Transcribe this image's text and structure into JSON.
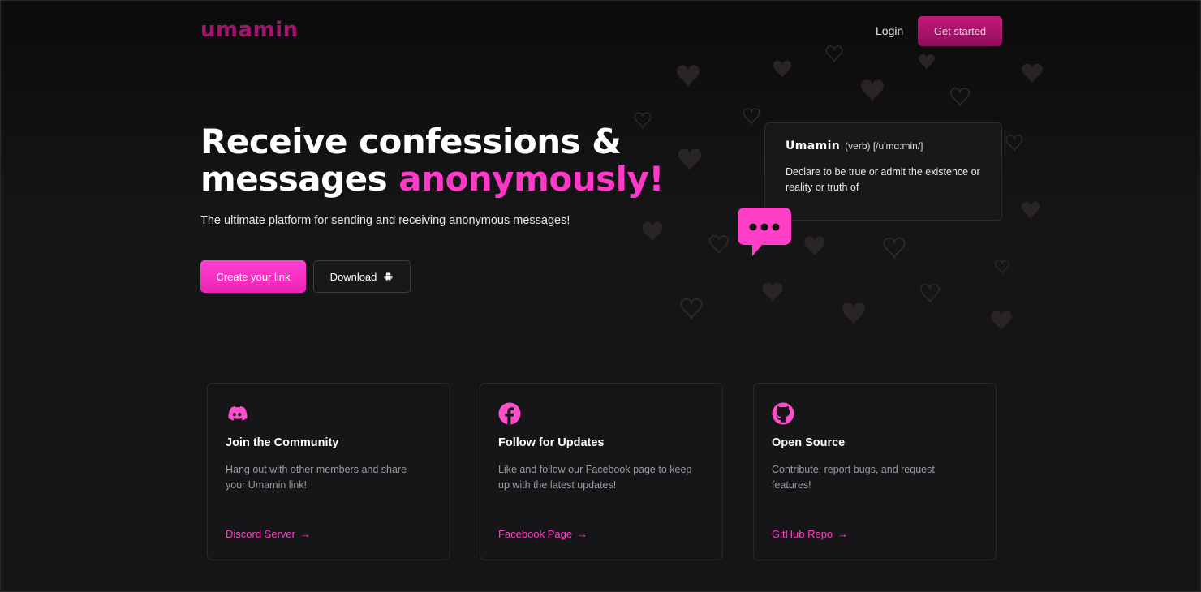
{
  "header": {
    "logo": "umamin",
    "login_label": "Login",
    "get_started_label": "Get started"
  },
  "hero": {
    "title_line1": "Receive confessions &",
    "title_line2_plain": "messages",
    "title_line2_accent": "anonymously!",
    "subtitle": "The ultimate platform for sending and receiving anonymous messages!",
    "create_label": "Create your link",
    "download_label": "Download"
  },
  "definition": {
    "word": "Umamin",
    "meta": "(verb) [/u'mɑ:min/]",
    "text": "Declare to be true or admit the existence or reality or truth of"
  },
  "cards": [
    {
      "title": "Join the Community",
      "text": "Hang out with other members and share your Umamin link!",
      "link": "Discord Server",
      "icon": "discord-icon"
    },
    {
      "title": "Follow for Updates",
      "text": "Like and follow our Facebook page to keep up with the latest updates!",
      "link": "Facebook Page",
      "icon": "facebook-icon"
    },
    {
      "title": "Open Source",
      "text": "Contribute, report bugs, and request features!",
      "link": "GitHub Repo",
      "icon": "github-icon"
    }
  ],
  "colors": {
    "accent": "#ff38c8",
    "logo": "#a3146e",
    "background": "#151517",
    "card_bg": "#161618"
  }
}
